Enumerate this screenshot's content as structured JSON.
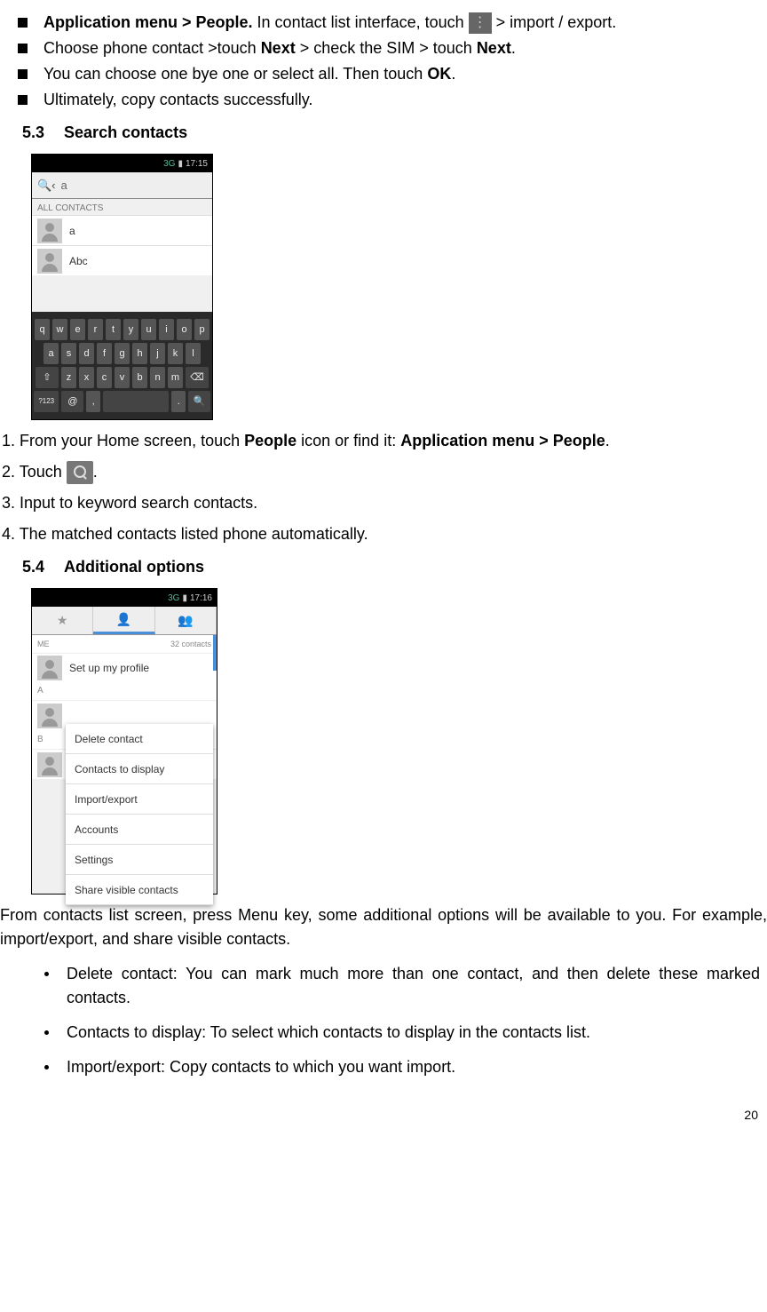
{
  "bullets_top": [
    {
      "prefix_bold": "Application menu > People.",
      "mid": " In contact list interface, touch ",
      "icon": "overflow-menu-icon",
      "suffix": "  > import / export."
    },
    {
      "html_parts": [
        "Choose phone contact >touch ",
        {
          "b": "Next"
        },
        " > check the SIM > touch ",
        {
          "b": "Next"
        },
        "."
      ]
    },
    {
      "html_parts": [
        "You can choose one bye one or select all. Then touch ",
        {
          "b": "OK"
        },
        "."
      ]
    },
    {
      "html_parts": [
        "Ultimately, copy contacts successfully."
      ]
    }
  ],
  "section53": {
    "num": "5.3",
    "title": "Search contacts"
  },
  "screenshot1": {
    "status_time": "17:15",
    "status_net": "3G",
    "search_letter": "a",
    "all_label": "ALL CONTACTS",
    "contacts": [
      "a",
      "Abc"
    ],
    "keyboard_rows": [
      [
        "q",
        "w",
        "e",
        "r",
        "t",
        "y",
        "u",
        "i",
        "o",
        "p"
      ],
      [
        "a",
        "s",
        "d",
        "f",
        "g",
        "h",
        "j",
        "k",
        "l"
      ],
      [
        "z",
        "x",
        "c",
        "v",
        "b",
        "n",
        "m"
      ]
    ],
    "sym_key": "?123",
    "at_key": "@",
    "comma_key": ",",
    "period_key": "."
  },
  "steps_53": {
    "s1_prefix": "1. From your Home screen, touch ",
    "s1_b1": "People",
    "s1_mid": " icon or find it: ",
    "s1_b2": "Application menu > People",
    "s1_suffix": ".",
    "s2_prefix": "2. Touch ",
    "s2_suffix": ".",
    "s3": "3. Input to keyword search contacts.",
    "s4": "4. The matched contacts listed phone automatically."
  },
  "section54": {
    "num": "5.4",
    "title": "Additional options"
  },
  "screenshot2": {
    "status_time": "17:16",
    "status_net": "3G",
    "me_label": "ME",
    "count_label": "32 contacts",
    "profile": "Set up my profile",
    "letterA": "A",
    "letterB": "B",
    "menu": [
      "Delete contact",
      "Contacts to display",
      "Import/export",
      "Accounts",
      "Settings",
      "Share visible contacts"
    ]
  },
  "para54": "From contacts list screen, press Menu key, some additional options will be available to you. For example, import/export, and share visible contacts.",
  "dot_bullets": [
    "Delete contact: You can mark much more than one contact, and then delete these marked contacts.",
    "Contacts to display: To select which contacts to display in the contacts list.",
    "Import/export: Copy contacts to which you want import."
  ],
  "page_no": "20"
}
